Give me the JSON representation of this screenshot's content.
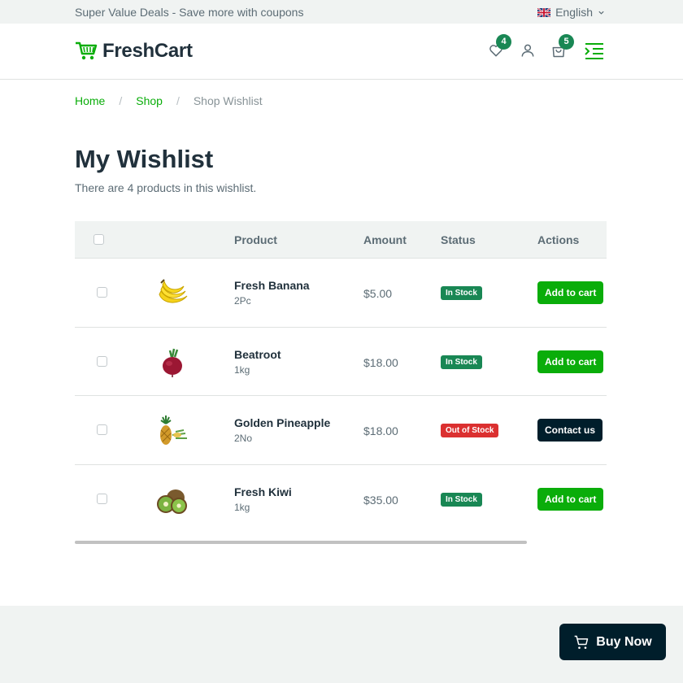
{
  "topbar": {
    "promo": "Super Value Deals - Save more with coupons",
    "language": "English"
  },
  "header": {
    "logo_text": "FreshCart",
    "wishlist_count": "4",
    "cart_count": "5",
    "brand_color": "#0aad0a"
  },
  "breadcrumb": {
    "home": "Home",
    "shop": "Shop",
    "current": "Shop Wishlist",
    "separator": "/"
  },
  "page": {
    "title": "My Wishlist",
    "subtitle": "There are 4 products in this wishlist."
  },
  "table": {
    "headers": {
      "product": "Product",
      "amount": "Amount",
      "status": "Status",
      "actions": "Actions"
    },
    "rows": [
      {
        "name": "Fresh Banana",
        "unit": "2Pc",
        "amount": "$5.00",
        "status": "In Stock",
        "action": "Add to cart",
        "image_icon": "banana-icon"
      },
      {
        "name": "Beatroot",
        "unit": "1kg",
        "amount": "$18.00",
        "status": "In Stock",
        "action": "Add to cart",
        "image_icon": "beetroot-icon"
      },
      {
        "name": "Golden Pineapple",
        "unit": "2No",
        "amount": "$18.00",
        "status": "Out of Stock",
        "action": "Contact us",
        "image_icon": "pineapple-icon"
      },
      {
        "name": "Fresh Kiwi",
        "unit": "1kg",
        "amount": "$35.00",
        "status": "In Stock",
        "action": "Add to cart",
        "image_icon": "kiwi-icon"
      }
    ]
  },
  "buy_now": {
    "label": "Buy Now"
  }
}
